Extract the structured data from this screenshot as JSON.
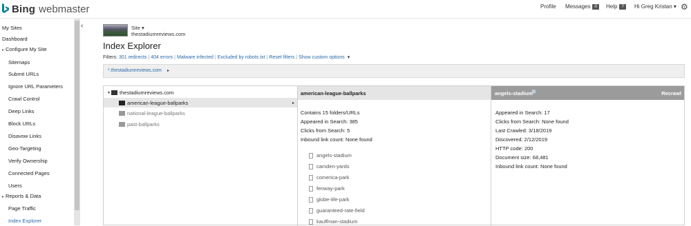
{
  "header": {
    "brand": "Bing",
    "product": "webmaster",
    "nav": {
      "profile": "Profile",
      "messages": "Messages",
      "messages_count": "0",
      "help": "Help",
      "help_badge": "?",
      "user": "Hi Greg Kristan",
      "user_caret": "▾"
    }
  },
  "sidebar": {
    "items": [
      {
        "label": "My Sites"
      },
      {
        "label": "Dashboard"
      },
      {
        "label": "Configure My Site"
      },
      {
        "label": "Sitemaps"
      },
      {
        "label": "Submit URLs"
      },
      {
        "label": "Ignore URL Parameters"
      },
      {
        "label": "Crawl Control"
      },
      {
        "label": "Deep Links"
      },
      {
        "label": "Block URLs"
      },
      {
        "label": "Disavow Links"
      },
      {
        "label": "Geo-Targeting"
      },
      {
        "label": "Verify Ownership"
      },
      {
        "label": "Connected Pages"
      },
      {
        "label": "Users"
      },
      {
        "label": "Reports & Data"
      },
      {
        "label": "Page Traffic"
      },
      {
        "label": "Index Explorer"
      }
    ]
  },
  "site": {
    "label": "Site ▾",
    "domain": "thestadiumreviews.com"
  },
  "page_title": "Index Explorer",
  "filters": {
    "prefix": "Filters:",
    "links": [
      "301 redirects",
      "404 errors",
      "Malware infected",
      "Excluded by robots.txt",
      "Reset filters",
      "Show custom options"
    ],
    "caret": "▾"
  },
  "path": {
    "text": "*.thestadiumreviews.com",
    "arrow": "▸"
  },
  "tree": {
    "root": "thestadiumreviews.com",
    "children": [
      "american-league-ballparks",
      "national-league-ballparks",
      "past-ballparks"
    ],
    "arrow": "▸"
  },
  "folder_panel": {
    "title": "american-league-ballparks",
    "stats": [
      "Contains 15 folders/URLs",
      "Appeared in Search: 385",
      "Clicks from Search: 5",
      "Inbound link count: None found"
    ],
    "files": [
      "angels-stadium",
      "camden-yards",
      "comerica-park",
      "fenway-park",
      "globe-life-park",
      "guaranteed-rate-field",
      "kauffman-stadium"
    ]
  },
  "detail_panel": {
    "title": "angels-stadium",
    "recrawl": "Recrawl",
    "stats": [
      "Appeared in Search: 17",
      "Clicks from Search: None found",
      "Last Crawled: 3/18/2019",
      "Discovered: 2/12/2019",
      "HTTP code: 200",
      "Document size: 68,481",
      "Inbound link count: None found"
    ]
  },
  "colors": {
    "link": "#2b6aa8",
    "bing_teal": "#00809d",
    "detail_header": "#9b9b9b"
  }
}
